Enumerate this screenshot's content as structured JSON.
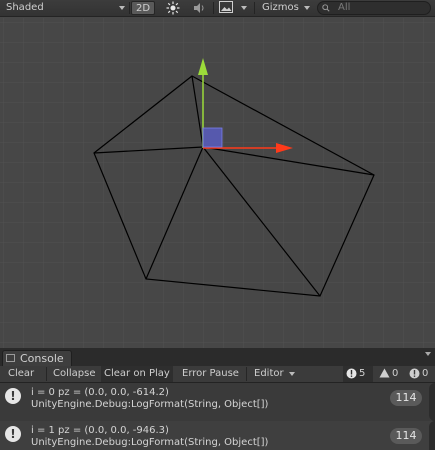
{
  "toolbar": {
    "draw_mode": "Shaded",
    "mode_2d": "2D",
    "gizmos": "Gizmos",
    "search_placeholder": "All",
    "icons": [
      "sun-icon",
      "audio-icon",
      "image-icon",
      "search-icon"
    ]
  },
  "scene": {
    "background": "#474747",
    "axis_x_color": "#ff3a1a",
    "axis_y_color": "#9cdc3a",
    "handle_color": "#5b5fcf"
  },
  "console": {
    "tab_label": "Console",
    "buttons": {
      "clear": "Clear",
      "collapse": "Collapse",
      "clear_on_play": "Clear on Play",
      "error_pause": "Error Pause",
      "editor": "Editor"
    },
    "counts": {
      "logs": "5",
      "warnings": "0",
      "errors": "0"
    },
    "entries": [
      {
        "line1": "i = 0 pz = (0.0, 0.0, -614.2)",
        "line2": "UnityEngine.Debug:LogFormat(String, Object[])",
        "count": "114"
      },
      {
        "line1": "i = 1 pz = (0.0, 0.0, -946.3)",
        "line2": "UnityEngine.Debug:LogFormat(String, Object[])",
        "count": "114"
      }
    ]
  }
}
